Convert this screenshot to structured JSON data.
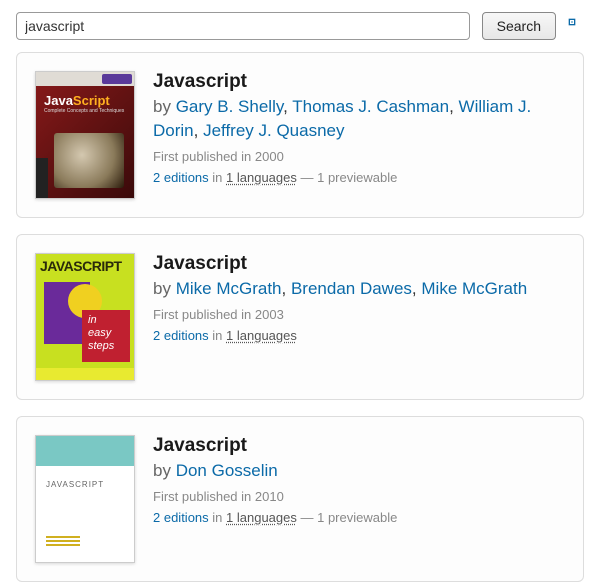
{
  "search": {
    "value": "javascript",
    "button_label": "Search"
  },
  "labels": {
    "by": "by",
    "in": "in",
    "comma": ", ",
    "dash": " — "
  },
  "results": [
    {
      "title": "Javascript",
      "authors": [
        "Gary B. Shelly",
        "Thomas J. Cashman",
        "William J. Dorin",
        "Jeffrey J. Quasney"
      ],
      "first_published": "First published in 2000",
      "editions": "2 editions",
      "languages": "1 languages",
      "previewable": "1 previewable",
      "cover": {
        "variant": 1,
        "title1": "Java",
        "title2": "Script",
        "sub": "Complete Concepts and Techniques"
      }
    },
    {
      "title": "Javascript",
      "authors": [
        "Mike McGrath",
        "Brendan Dawes",
        "Mike McGrath"
      ],
      "first_published": "First published in 2003",
      "editions": "2 editions",
      "languages": "1 languages",
      "previewable": null,
      "cover": {
        "variant": 2,
        "js_title": "JAVASCRIPT",
        "easy1": "in",
        "easy2": "easy",
        "easy3": "steps"
      }
    },
    {
      "title": "Javascript",
      "authors": [
        "Don Gosselin"
      ],
      "first_published": "First published in 2010",
      "editions": "2 editions",
      "languages": "1 languages",
      "previewable": "1 previewable",
      "cover": {
        "variant": 3,
        "label": "JAVASCRIPT"
      }
    }
  ]
}
